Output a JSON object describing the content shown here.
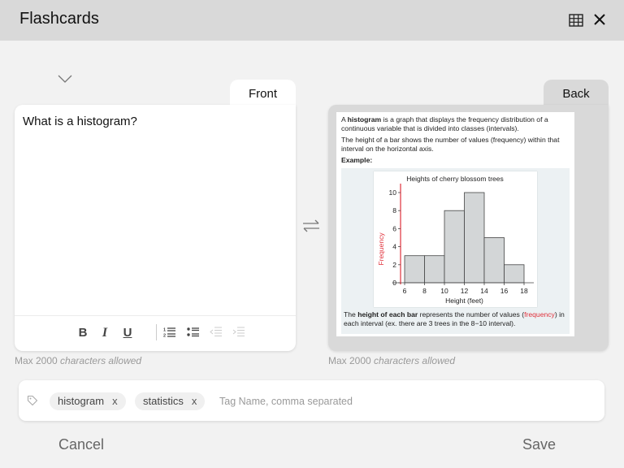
{
  "app": {
    "title": "Flashcards",
    "grid_icon": "grid-icon",
    "close_icon": "close-icon"
  },
  "collapse_icon": "chevron-down-icon",
  "front": {
    "tab_label": "Front",
    "text": "What is a histogram?",
    "toolbar": {
      "bold": "B",
      "italic": "I",
      "underline": "U",
      "items": [
        "bold",
        "italic",
        "underline",
        "numbered-list",
        "bullet-list",
        "outdent",
        "indent"
      ]
    },
    "hint_prefix": "Max 2000 ",
    "hint_suffix": "characters allowed"
  },
  "swap_icon": "swap-arrows-icon",
  "back": {
    "tab_label": "Back",
    "para1_pre": "A ",
    "para1_bold": "histogram",
    "para1_post": " is a graph that displays the frequency distribution of a continuous variable that is divided into classes (intervals).",
    "para2": "The height of a bar shows the number of values (frequency) within that interval on the horizontal axis.",
    "example_label": "Example:",
    "note_pre": "The ",
    "note_bold": "height of each bar",
    "note_mid": " represents the number of values (",
    "note_red": "frequency",
    "note_post": ") in each interval (ex. there are 3 trees in the 8−10 interval).",
    "hint_prefix": "Max 2000 ",
    "hint_suffix": "characters allowed"
  },
  "chart_data": {
    "type": "bar",
    "title": "Heights of cherry blossom trees",
    "xlabel": "Height (feet)",
    "ylabel": "Frequency",
    "bins": [
      [
        6,
        8
      ],
      [
        8,
        10
      ],
      [
        10,
        12
      ],
      [
        12,
        14
      ],
      [
        14,
        16
      ],
      [
        16,
        18
      ]
    ],
    "values": [
      3,
      3,
      8,
      10,
      5,
      2
    ],
    "x_ticks": [
      6,
      8,
      10,
      12,
      14,
      16,
      18
    ],
    "y_ticks": [
      0,
      2,
      4,
      6,
      8,
      10
    ],
    "xlim": [
      6,
      18
    ],
    "ylim": [
      0,
      10
    ],
    "colors": {
      "bar": "#d3d6d7",
      "bar_edge": "#444444",
      "y_axis": "#e0303a",
      "ylabel": "#e0303a"
    }
  },
  "tags": {
    "icon": "tag-icon",
    "items": [
      {
        "label": "histogram",
        "remove": "x"
      },
      {
        "label": "statistics",
        "remove": "x"
      }
    ],
    "placeholder": "Tag Name, comma separated",
    "value": ""
  },
  "actions": {
    "cancel": "Cancel",
    "save": "Save"
  }
}
